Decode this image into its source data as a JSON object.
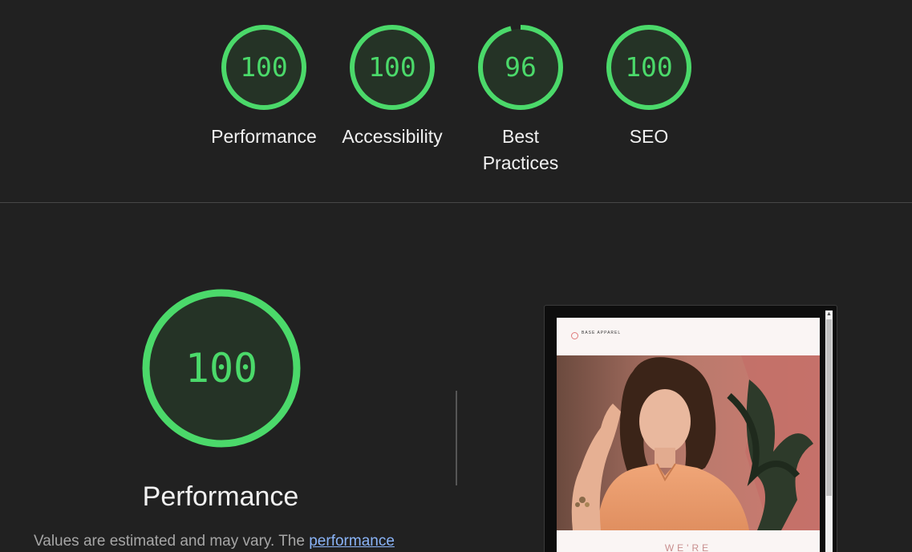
{
  "scores": [
    {
      "label": "Performance",
      "value": "100",
      "score": 1.0
    },
    {
      "label": "Accessibility",
      "value": "100",
      "score": 1.0
    },
    {
      "label": "Best Practices",
      "value": "96",
      "score": 0.96
    },
    {
      "label": "SEO",
      "value": "100",
      "score": 1.0
    }
  ],
  "performance": {
    "value": "100",
    "score": 1.0,
    "title": "Performance",
    "desc_prefix": "Values are estimated and may vary. The ",
    "desc_link": "performance"
  },
  "screenshot": {
    "logo_text": "BASE APPAREL",
    "tagline": "WE'RE"
  },
  "colors": {
    "pass": "#4bd96a",
    "gauge_fill": "#253326",
    "background": "#212121",
    "link": "#8ab4f8"
  }
}
